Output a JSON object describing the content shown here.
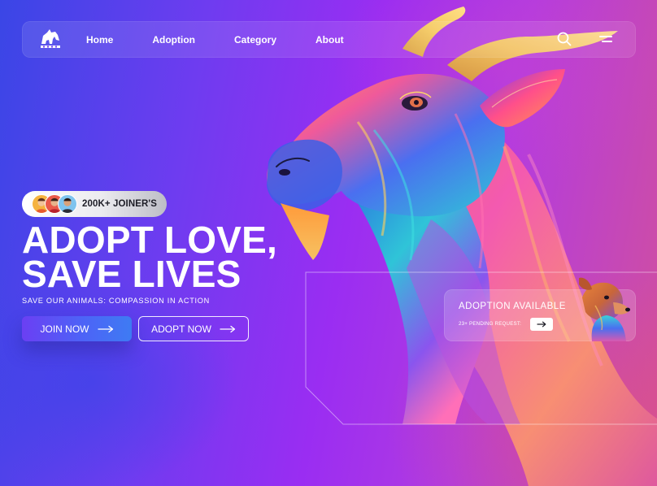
{
  "nav": {
    "logo_icon": "horse-logo-icon",
    "links": [
      {
        "label": "Home"
      },
      {
        "label": "Adoption"
      },
      {
        "label": "Category"
      },
      {
        "label": "About"
      }
    ],
    "search_icon": "search-icon",
    "menu_icon": "menu-icon"
  },
  "hero": {
    "joiners_text": "200K+ JOINER'S",
    "title_line1": "ADOPT LOVE,",
    "title_line2": "SAVE LIVES",
    "subtitle": "SAVE OUR ANIMALS: COMPASSION IN ACTION",
    "join_button": "JOIN NOW",
    "adopt_button": "ADOPT NOW",
    "button_icon": "arrow-right-icon"
  },
  "adoption_card": {
    "title": "ADOPTION AVAILABLE",
    "subtitle": "23+ PENDING REQUEST:",
    "button_icon": "arrow-right-icon"
  },
  "colors": {
    "background_start": "#3a46e6",
    "background_mid": "#9a2df2",
    "background_end": "#d2509c",
    "join_button": "#4d63f7",
    "text": "#ffffff"
  }
}
